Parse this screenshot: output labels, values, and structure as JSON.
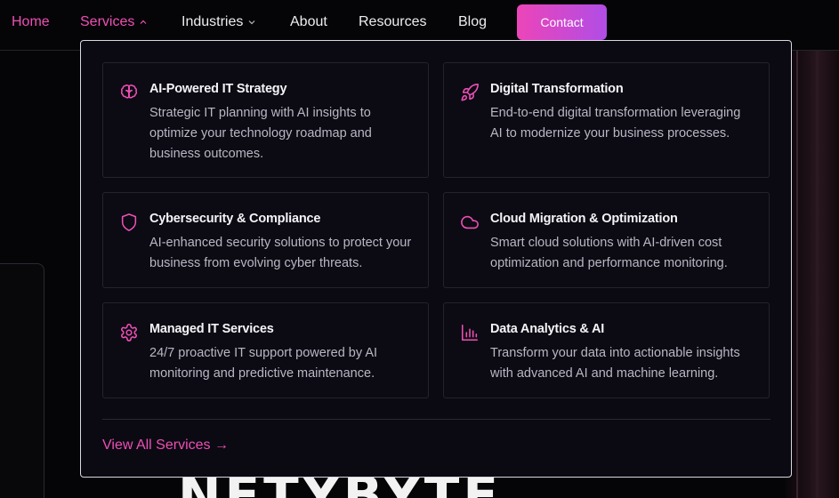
{
  "nav": {
    "items": [
      {
        "label": "Home"
      },
      {
        "label": "Services"
      },
      {
        "label": "Industries"
      },
      {
        "label": "About"
      },
      {
        "label": "Resources"
      },
      {
        "label": "Blog"
      }
    ],
    "contact_label": "Contact"
  },
  "dropdown": {
    "services": [
      {
        "title": "AI-Powered IT Strategy",
        "description": "Strategic IT planning with AI insights to optimize your technology roadmap and business outcomes.",
        "icon": "brain-icon"
      },
      {
        "title": "Digital Transformation",
        "description": "End-to-end digital transformation leveraging AI to modernize your business processes.",
        "icon": "rocket-icon"
      },
      {
        "title": "Cybersecurity & Compliance",
        "description": "AI-enhanced security solutions to protect your business from evolving cyber threats.",
        "icon": "shield-icon"
      },
      {
        "title": "Cloud Migration & Optimization",
        "description": "Smart cloud solutions with AI-driven cost optimization and performance monitoring.",
        "icon": "cloud-icon"
      },
      {
        "title": "Managed IT Services",
        "description": "24/7 proactive IT support powered by AI monitoring and predictive maintenance.",
        "icon": "gear-icon"
      },
      {
        "title": "Data Analytics & AI",
        "description": "Transform your data into actionable insights with advanced AI and machine learning.",
        "icon": "bar-chart-icon"
      }
    ],
    "view_all_label": "View All Services →"
  },
  "hero": {
    "title_fragment": "NETYBYTE"
  },
  "colors": {
    "accent": "#ee4fb6",
    "accent_end": "#b14de6",
    "background": "#050507",
    "panel": "#0b0a12"
  }
}
